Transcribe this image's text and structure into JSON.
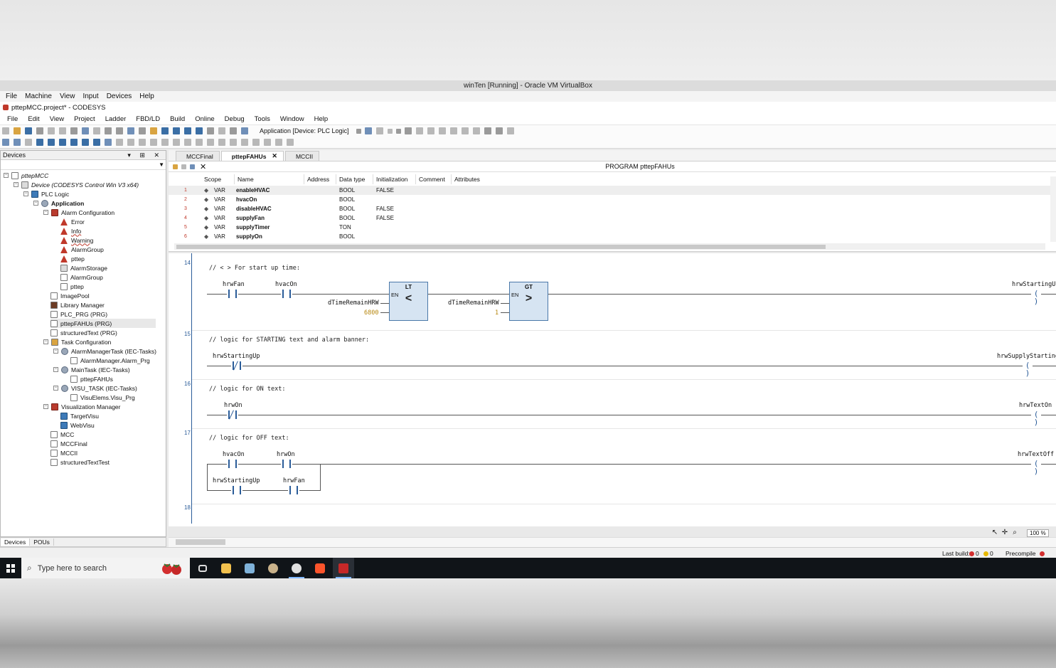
{
  "vbox": {
    "title": "winTen [Running] - Oracle VM VirtualBox",
    "menu": [
      "File",
      "Machine",
      "View",
      "Input",
      "Devices",
      "Help"
    ]
  },
  "app": {
    "title": "pttepMCC.project* - CODESYS",
    "menu": [
      "File",
      "Edit",
      "View",
      "Project",
      "Ladder",
      "FBD/LD",
      "Build",
      "Online",
      "Debug",
      "Tools",
      "Window",
      "Help"
    ],
    "app_combo": "Application [Device: PLC Logic]"
  },
  "devices": {
    "title": "Devices",
    "tree": {
      "root": "pttepMCC",
      "device": "Device (CODESYS Control Win V3 x64)",
      "plc": "PLC Logic",
      "application": "Application",
      "alarm_config": "Alarm Configuration",
      "error": "Error",
      "info": "Info",
      "warning": "Warning",
      "alarmgroup1": "AlarmGroup",
      "pttep1": "pttep",
      "alarmstorage": "AlarmStorage",
      "alarmgroup2": "AlarmGroup",
      "pttep2": "pttep",
      "imagepool": "ImagePool",
      "libmgr": "Library Manager",
      "plcprg": "PLC_PRG (PRG)",
      "fahus": "pttepFAHUs (PRG)",
      "structured": "structuredText (PRG)",
      "taskcfg": "Task Configuration",
      "alarmtask": "AlarmManagerTask (IEC-Tasks)",
      "alarmprg": "AlarmManager.Alarm_Prg",
      "maintask": "MainTask (IEC-Tasks)",
      "mainprg": "pttepFAHUs",
      "visutask": "VISU_TASK (IEC-Tasks)",
      "visuprg": "VisuElems.Visu_Prg",
      "vismgr": "Visualization Manager",
      "targetvisu": "TargetVisu",
      "webvisu": "WebVisu",
      "mcc": "MCC",
      "mccfinal": "MCCFinal",
      "mccii": "MCCII",
      "sttest": "structuredTextTest"
    },
    "tabs": [
      "Devices",
      "POUs"
    ]
  },
  "editor": {
    "tabs": [
      "MCCFinal",
      "pttepFAHUs",
      "MCCII"
    ],
    "program_title": "PROGRAM pttepFAHUs",
    "columns": [
      "Scope",
      "Name",
      "Address",
      "Data type",
      "Initialization",
      "Comment",
      "Attributes"
    ],
    "vars": [
      {
        "n": "1",
        "scope": "VAR",
        "name": "enableHVAC",
        "type": "BOOL",
        "init": "FALSE"
      },
      {
        "n": "2",
        "scope": "VAR",
        "name": "hvacOn",
        "type": "BOOL",
        "init": ""
      },
      {
        "n": "3",
        "scope": "VAR",
        "name": "disableHVAC",
        "type": "BOOL",
        "init": "FALSE"
      },
      {
        "n": "4",
        "scope": "VAR",
        "name": "supplyFan",
        "type": "BOOL",
        "init": "FALSE"
      },
      {
        "n": "5",
        "scope": "VAR",
        "name": "supplyTimer",
        "type": "TON",
        "init": ""
      },
      {
        "n": "6",
        "scope": "VAR",
        "name": "supplyOn",
        "type": "BOOL",
        "init": ""
      }
    ]
  },
  "ladder": {
    "r14": {
      "num": "14",
      "comment": "// < > For start up time:",
      "c1": "hrwFan",
      "c2": "hvacOn",
      "lt_title": "LT",
      "lt_op": "<",
      "en": "EN",
      "lt_in1": "dTimeRemainHRW",
      "lt_in2": "6800",
      "gt_title": "GT",
      "gt_op": ">",
      "gt_in1": "dTimeRemainHRW",
      "gt_in2": "1",
      "coil": "hrwStartingUp"
    },
    "r15": {
      "num": "15",
      "comment": "// logic for STARTING text and alarm banner:",
      "c1": "hrwStartingUp",
      "coil": "hrwSupplyStarting"
    },
    "r16": {
      "num": "16",
      "comment": "// logic for ON text:",
      "c1": "hrwOn",
      "coil": "hrwTextOn"
    },
    "r17": {
      "num": "17",
      "comment": "// logic for OFF text:",
      "c1": "hvacOn",
      "c2": "hrwOn",
      "c3": "hrwStartingUp",
      "c4": "hrwFan",
      "coil": "hrwTextOff"
    },
    "r18": {
      "num": "18"
    },
    "coil_glyph": "( )"
  },
  "zoom": "100 %",
  "status": {
    "last_build": "Last build:",
    "errors": "0",
    "warnings": "0",
    "precompile": "Precompile"
  },
  "taskbar": {
    "search_placeholder": "Type here to search"
  }
}
